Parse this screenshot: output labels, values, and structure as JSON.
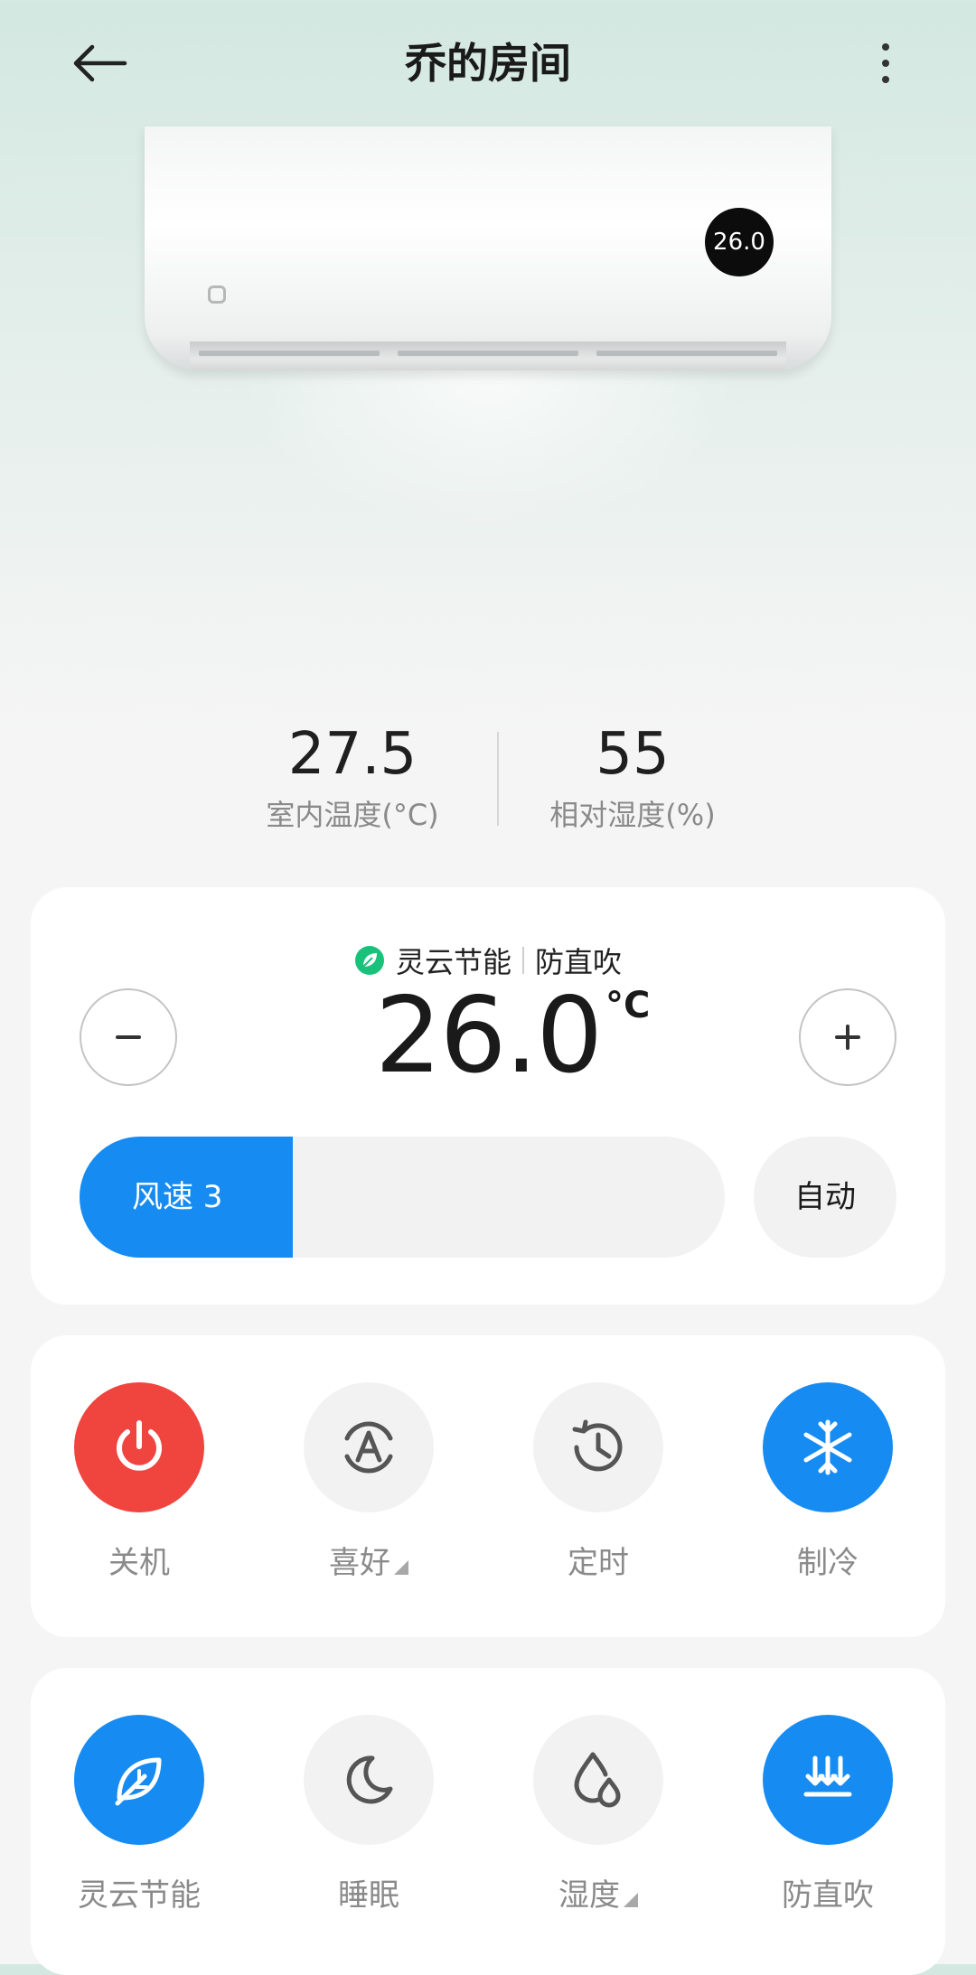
{
  "header": {
    "title": "乔的房间"
  },
  "device": {
    "display_value": "26.0"
  },
  "readings": {
    "indoor_temp": {
      "value": "27.5",
      "label": "室内温度(°C)"
    },
    "humidity": {
      "value": "55",
      "label": "相对湿度(%)"
    }
  },
  "temperature_card": {
    "mode_primary": "灵云节能",
    "mode_secondary": "防直吹",
    "set_temp": "26.0",
    "unit": "°C",
    "fan": {
      "label": "风速 3",
      "level_fraction": 0.33
    },
    "auto_label": "自动"
  },
  "modes": [
    {
      "label": "关机",
      "icon": "power-icon",
      "color": "#f0443f"
    },
    {
      "label": "喜好",
      "icon": "auto-preference-icon",
      "has_dropdown": true
    },
    {
      "label": "定时",
      "icon": "timer-icon"
    },
    {
      "label": "制冷",
      "icon": "snowflake-icon",
      "color": "#168bf2"
    }
  ],
  "functions": [
    {
      "label": "灵云节能",
      "icon": "leaf-icon",
      "color": "#168bf2"
    },
    {
      "label": "睡眠",
      "icon": "moon-icon"
    },
    {
      "label": "湿度",
      "icon": "humidity-icon",
      "has_dropdown": true
    },
    {
      "label": "防直吹",
      "icon": "anti-direct-blow-icon",
      "color": "#168bf2"
    }
  ],
  "colors": {
    "accent": "#168bf2",
    "power": "#f0443f",
    "eco_green": "#19c27a"
  }
}
